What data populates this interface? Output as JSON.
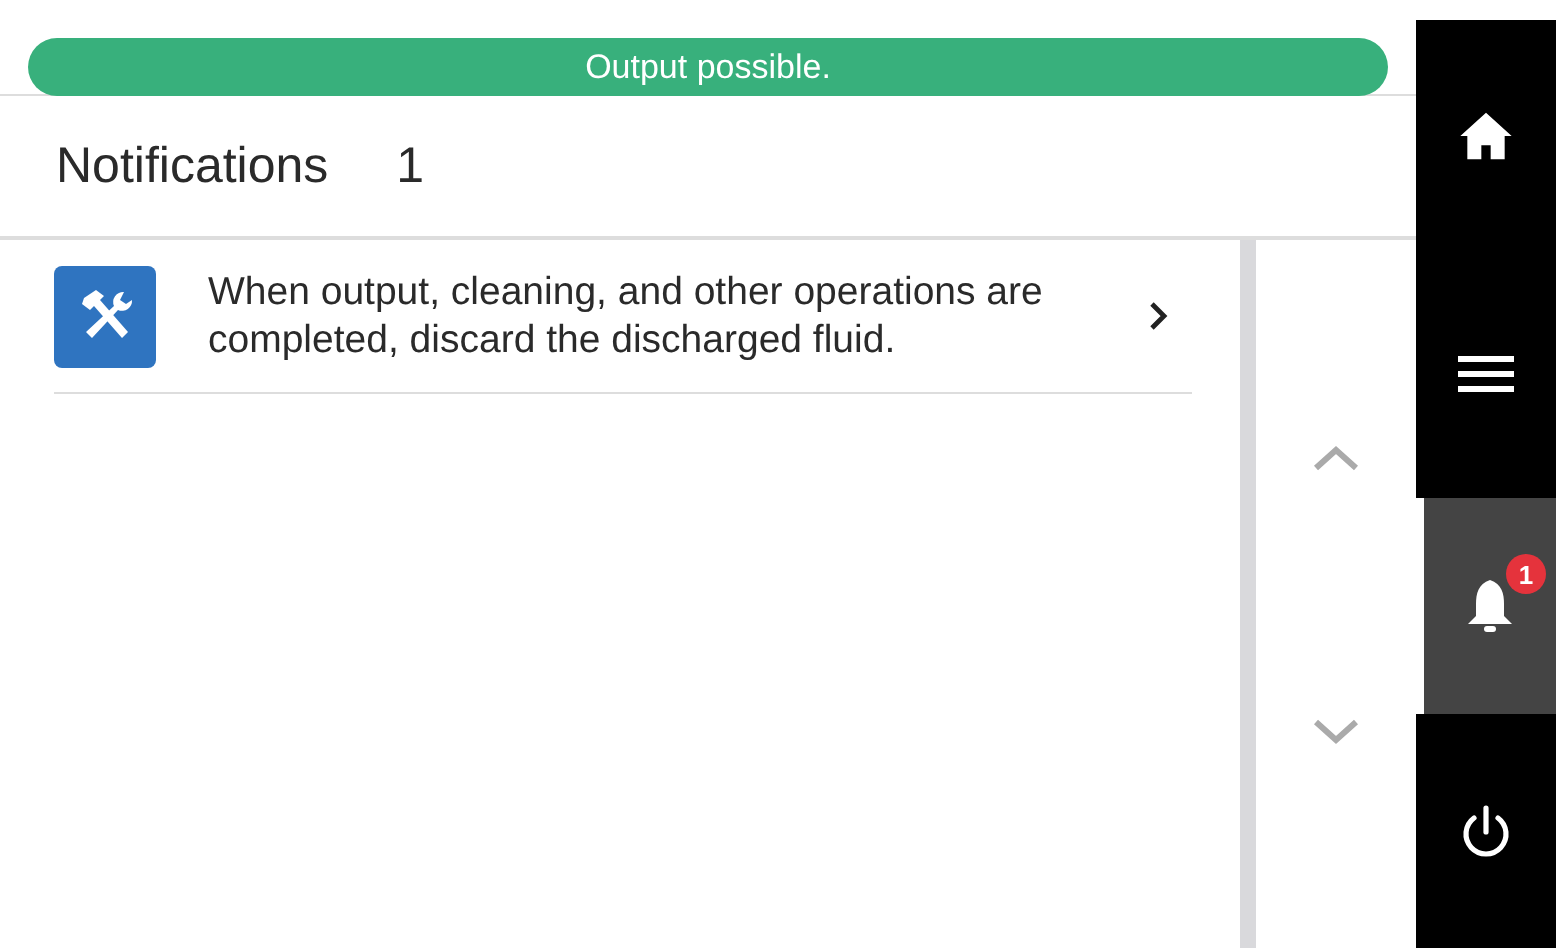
{
  "status_bar": {
    "text": "Output possible."
  },
  "header": {
    "title": "Notifications",
    "count": "1"
  },
  "notifications": [
    {
      "text": "When output, cleaning, and other operations are completed, discard the discharged fluid."
    }
  ],
  "sidebar": {
    "items": [
      {
        "kind": "home",
        "selected": false
      },
      {
        "kind": "menu",
        "selected": false
      },
      {
        "kind": "notifications",
        "selected": true,
        "badge": "1"
      },
      {
        "kind": "power",
        "selected": false
      }
    ]
  }
}
